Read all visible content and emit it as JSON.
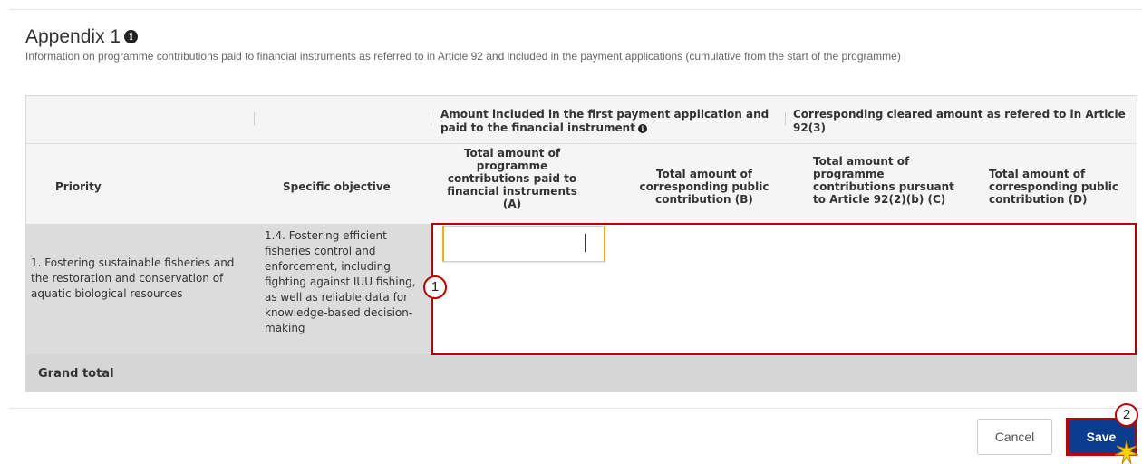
{
  "header": {
    "title": "Appendix 1",
    "subtitle": "Information on programme contributions paid to financial instruments as referred to in Article 92 and included in the payment applications (cumulative from the start of the programme)"
  },
  "table": {
    "group_headers": {
      "first_payment": "Amount included in the first payment application and paid to the financial instrument",
      "cleared": "Corresponding cleared amount as refered to in Article 92(3)"
    },
    "columns": {
      "priority": "Priority",
      "specific_objective": "Specific objective",
      "col_a": "Total amount of programme contributions paid to financial instruments (A)",
      "col_b": "Total amount of corresponding public contribution (B)",
      "col_c": "Total amount of programme contributions pursuant to Article 92(2)(b) (C)",
      "col_d": "Total amount of corresponding public contribution (D)"
    },
    "rows": [
      {
        "priority": "1. Fostering sustainable fisheries and the restoration and conservation of aquatic biological resources",
        "specific_objective": "1.4. Fostering efficient fisheries control and enforcement, including fighting against IUU fishing, as well as reliable data for knowledge-based decision-making",
        "col_a_value": ""
      }
    ],
    "grand_total_label": "Grand total"
  },
  "annotations": {
    "callout_1": "1",
    "callout_2": "2"
  },
  "footer": {
    "cancel_label": "Cancel",
    "save_label": "Save"
  },
  "colors": {
    "primary": "#0a3d8f",
    "highlight": "#c00000",
    "focus": "#f0b400"
  },
  "icons": {
    "info": "info-icon"
  }
}
